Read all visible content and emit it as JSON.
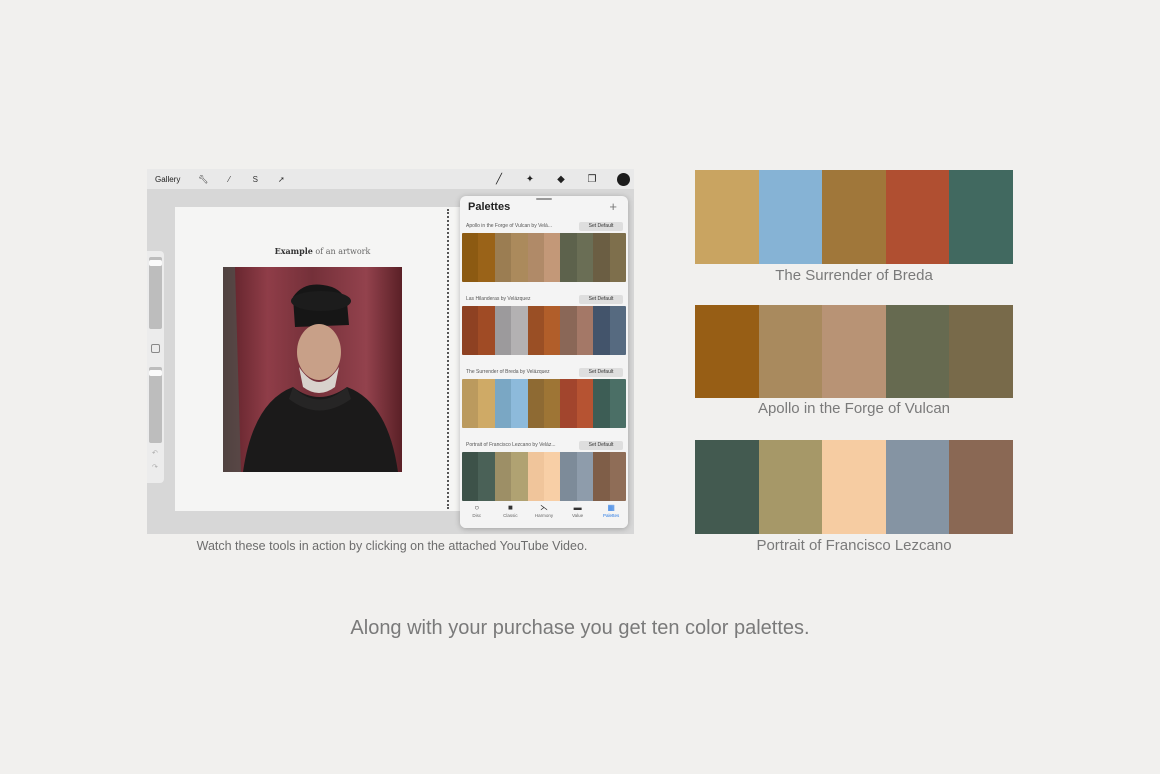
{
  "app": {
    "toolbar": {
      "gallery_label": "Gallery",
      "left_icons": [
        "wrench-icon",
        "magic-wand-icon",
        "selection-icon",
        "move-arrow-icon"
      ],
      "right_icons": [
        "brush-icon",
        "smudge-icon",
        "eraser-icon",
        "layers-icon"
      ],
      "current_color": "#1c1c1c"
    },
    "canvas": {
      "title_bold": "Example",
      "title_rest": " of an artwork"
    },
    "palettes_panel": {
      "title": "Palettes",
      "add_label": "+",
      "palettes": [
        {
          "name": "Apollo in the Forge of Vulcan by Velá...",
          "button": "Set Default",
          "colors": [
            "#8c5a12",
            "#9a6318",
            "#9b7d52",
            "#ab8a5c",
            "#b08a68",
            "#c39878",
            "#5d624c",
            "#6a6e55",
            "#6b5e43",
            "#7e6f4c"
          ]
        },
        {
          "name": "Las Hilanderas by Velázquez",
          "button": "Set Default",
          "colors": [
            "#8e4122",
            "#a04b25",
            "#9c9a9c",
            "#b3b1b2",
            "#9a4f25",
            "#b15e2a",
            "#8a6757",
            "#a47867",
            "#43546b",
            "#566a80"
          ]
        },
        {
          "name": "The Surrender of Breda by Velázquez",
          "button": "Set Default",
          "colors": [
            "#bb9a5e",
            "#cfaa66",
            "#7aa7c4",
            "#8dbadb",
            "#8e6a33",
            "#9e7535",
            "#a2452d",
            "#b65332",
            "#3d5d55",
            "#4b6f66"
          ]
        },
        {
          "name": "Portrait of Francisco Lezcano by Veláz...",
          "button": "Set Default",
          "colors": [
            "#3d5249",
            "#4a6157",
            "#9d8f66",
            "#b0a272",
            "#f0c59b",
            "#f8cfa6",
            "#7d8b99",
            "#8e9cab",
            "#7f5e48",
            "#8f6d57"
          ]
        }
      ],
      "bottom_tabs": [
        {
          "label": "Disc",
          "icon": "disc-icon",
          "glyph": "○"
        },
        {
          "label": "Classic",
          "icon": "classic-icon",
          "glyph": "■"
        },
        {
          "label": "Harmony",
          "icon": "harmony-icon",
          "glyph": "⋋"
        },
        {
          "label": "Value",
          "icon": "value-icon",
          "glyph": "▬"
        },
        {
          "label": "Palettes",
          "icon": "palettes-icon",
          "glyph": "▦"
        }
      ]
    }
  },
  "caption_left": "Watch these tools in action by clicking on the attached YouTube Video.",
  "big_palettes": [
    {
      "caption": "The Surrender of Breda",
      "colors": [
        "#c9a461",
        "#86b3d5",
        "#a0773a",
        "#b04f31",
        "#416960"
      ]
    },
    {
      "caption": "Apollo in the Forge of Vulcan",
      "colors": [
        "#975e15",
        "#a98a5e",
        "#b89375",
        "#666a50",
        "#786a4a"
      ]
    },
    {
      "caption": "Portrait of Francisco Lezcano",
      "colors": [
        "#435a50",
        "#a69868",
        "#f6cca2",
        "#8594a3",
        "#8a6854"
      ]
    }
  ],
  "tagline": "Along with your purchase you get ten color palettes."
}
